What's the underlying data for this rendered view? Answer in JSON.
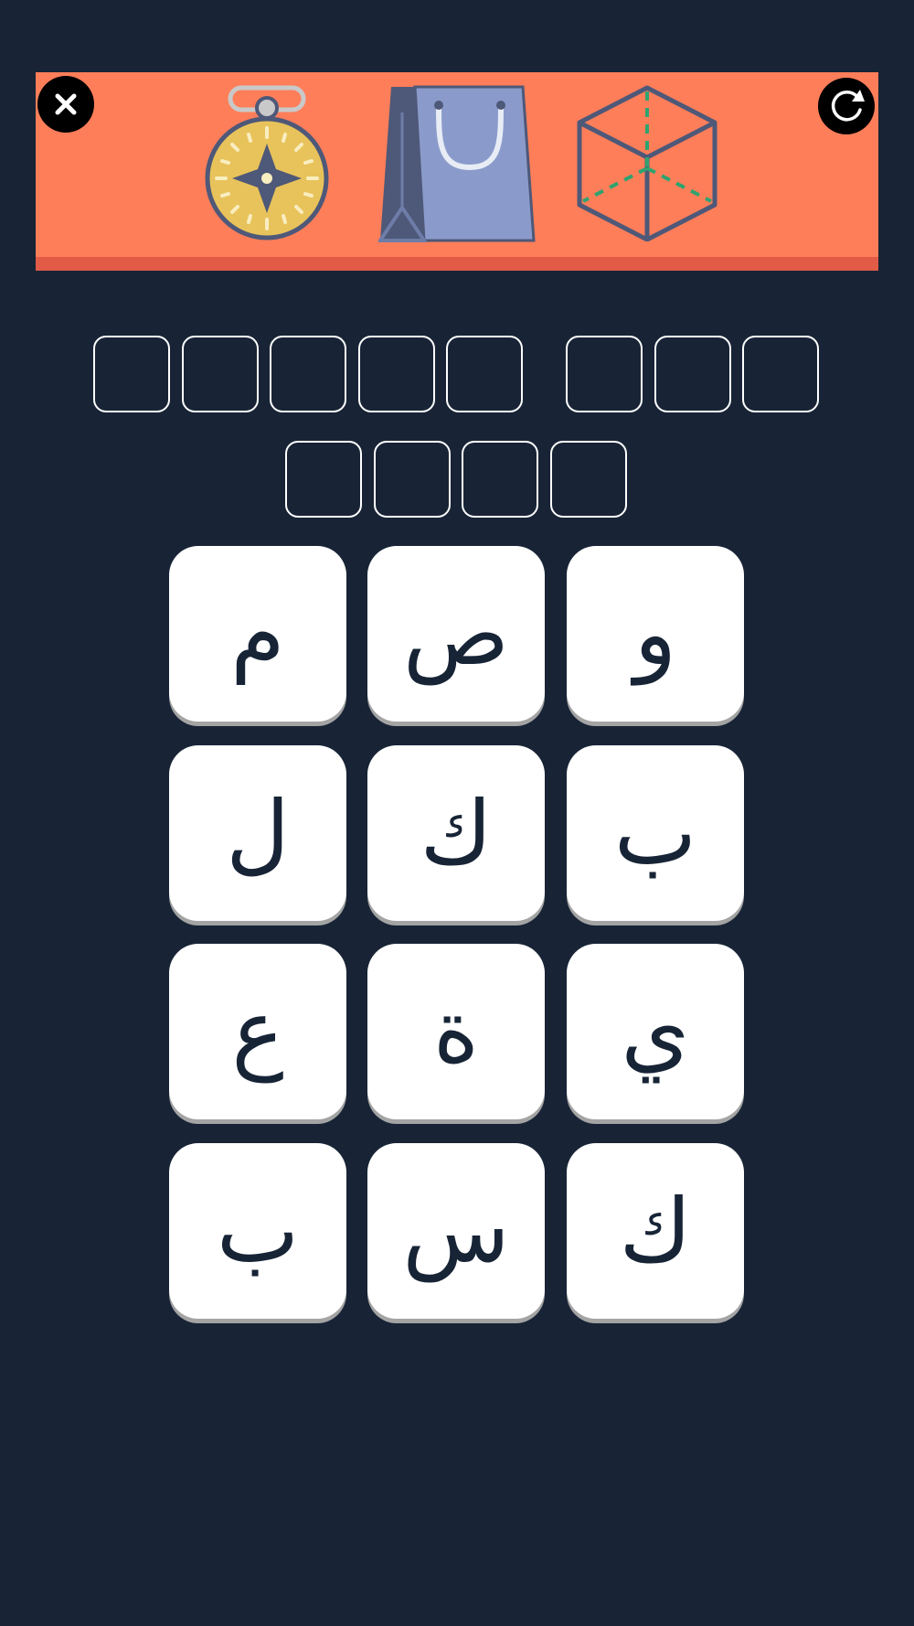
{
  "header": {
    "close_icon": "close-icon",
    "reset_icon": "refresh-icon",
    "clue_pictures": [
      "compass-icon",
      "shopping-bag-icon",
      "cube-icon"
    ]
  },
  "answer": {
    "word_lengths": [
      5,
      3,
      4
    ]
  },
  "letters": {
    "row1": [
      "م",
      "ص",
      "و"
    ],
    "row2": [
      "ل",
      "ك",
      "ب"
    ],
    "row3": [
      "ع",
      "ة",
      "ي"
    ],
    "row4": [
      "ب",
      "س",
      "ك"
    ]
  },
  "colors": {
    "background": "#182436",
    "banner": "#fe7e5a",
    "banner_stripe": "#e15b47",
    "tile": "#ffffff",
    "tile_shadow": "#a4a4a4",
    "letter": "#172436"
  }
}
